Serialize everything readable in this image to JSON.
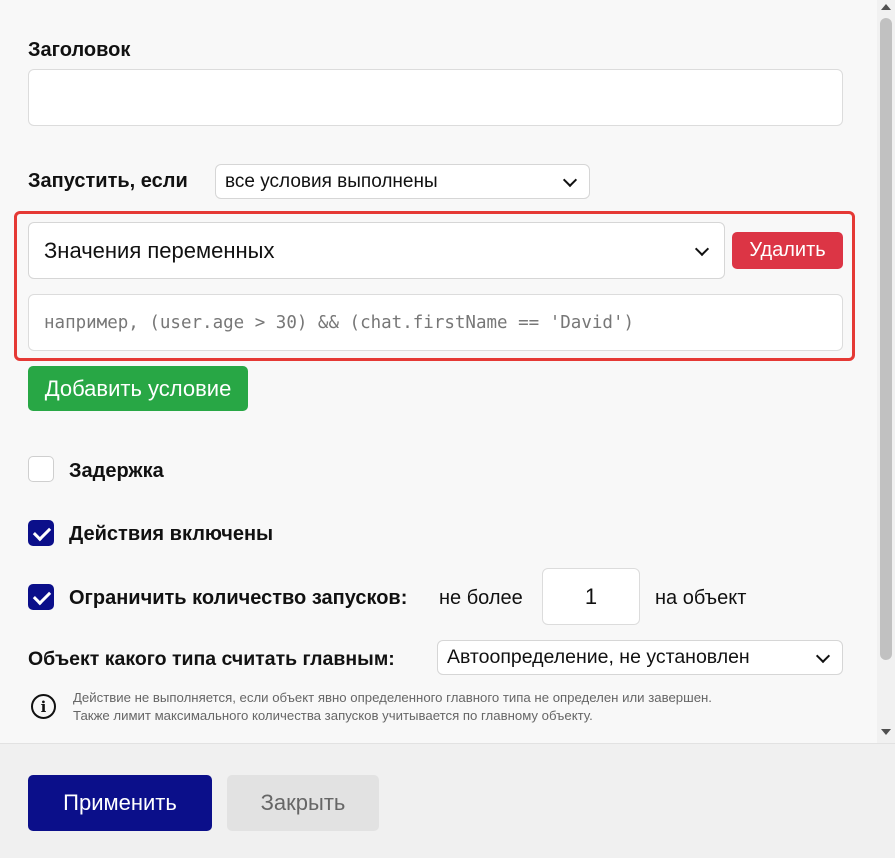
{
  "form": {
    "title_label": "Заголовок",
    "title_value": "",
    "run_if_label": "Запустить, если",
    "run_if_select": "все условия выполнены",
    "condition": {
      "type_select": "Значения переменных",
      "delete_label": "Удалить",
      "expression_placeholder": "например, (user.age > 30) && (chat.firstName == 'David')"
    },
    "add_condition_label": "Добавить условие",
    "delay": {
      "label": "Задержка",
      "checked": false
    },
    "actions_enabled": {
      "label": "Действия включены",
      "checked": true
    },
    "limit_runs": {
      "label": "Ограничить количество запусков:",
      "checked": true,
      "prefix": "не более",
      "value": "1",
      "suffix": "на объект"
    },
    "main_object": {
      "label": "Объект какого типа считать главным:",
      "select": "Автоопределение, не установлен"
    },
    "info": {
      "icon": "info-icon",
      "line1": "Действие не выполняется, если объект явно определенного главного типа не определен или завершен.",
      "line2": "Также лимит максимального количества запусков учитывается по главному объекту."
    }
  },
  "footer": {
    "apply_label": "Применить",
    "close_label": "Закрыть"
  },
  "colors": {
    "primary": "#0b0f8a",
    "danger": "#dc3545",
    "success": "#28a745",
    "highlight_border": "#e53935"
  }
}
